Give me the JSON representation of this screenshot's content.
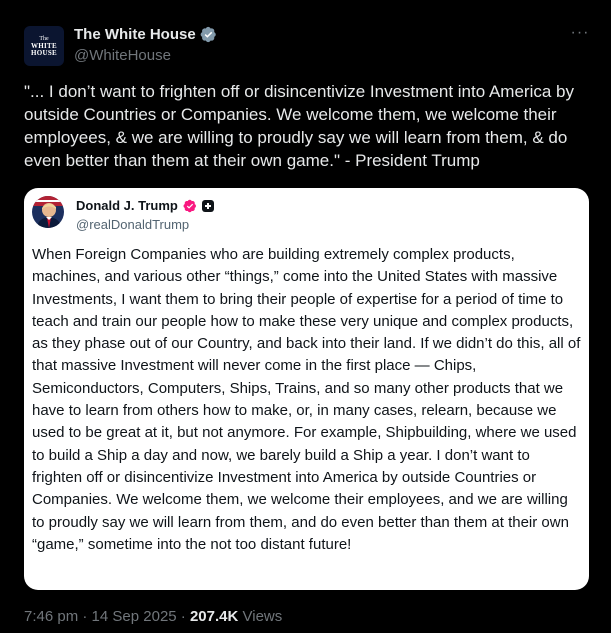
{
  "post": {
    "author": {
      "name": "The White House",
      "handle": "@WhiteHouse",
      "avatar_text": [
        "The",
        "WHITE",
        "HOUSE"
      ],
      "badge_icon": "gray-verified-badge-icon"
    },
    "more_icon": "more-options-icon",
    "text": "\"... I don’t want to frighten off or disincentivize Investment into America by outside Countries or Companies. We welcome them, we welcome their employees, & we are willing to proudly say we will learn from them, & do even better than them at their own game.\" - President Trump",
    "quote": {
      "author": {
        "name": "Donald J. Trump",
        "handle": "@realDonaldTrump",
        "badge_icon": "pink-verified-badge-icon",
        "extra_badge_icon": "affiliate-badge-icon"
      },
      "text": "When Foreign Companies who are building extremely complex products, machines, and various other “things,” come into the United States with massive Investments, I want them to bring their people of expertise for a period of time to teach and train our people how to make these very unique and complex products, as they phase out of our Country, and back into their land. If we didn’t do this, all of that massive Investment will never come in the first place — Chips, Semiconductors, Computers, Ships, Trains, and so many other products that we have to learn from others how to make, or, in many cases, relearn, because we used to be great at it, but not anymore. For example, Shipbuilding, where we used to build a Ship a day and now, we barely build a Ship a year. I don’t want to frighten off or disincentivize Investment into America by outside Countries or Companies. We welcome them, we welcome their employees, and we are willing to proudly say we will learn from them, and do even better than them at their own “game,” sometime into the not too distant future!"
    },
    "meta": {
      "time": "7:46 pm",
      "separator": "·",
      "date": "14 Sep 2025",
      "views_count": "207.4K",
      "views_label": "Views"
    }
  },
  "colors": {
    "background": "#000000",
    "text_primary": "#e7e9ea",
    "text_secondary": "#71767b",
    "quote_background": "#ffffff",
    "verified_pink": "#f91880"
  }
}
